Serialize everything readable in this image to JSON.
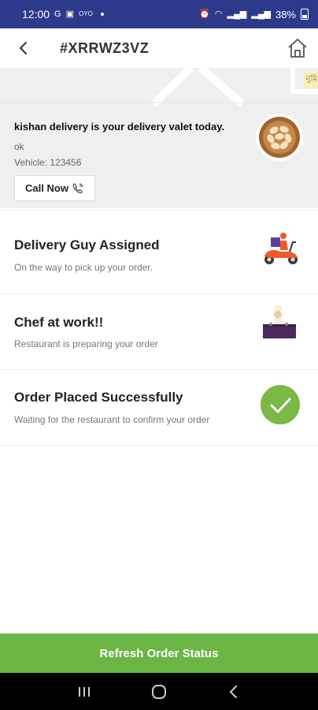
{
  "status_bar": {
    "time": "12:00",
    "battery": "38%"
  },
  "header": {
    "order_id": "#XRRWZ3VZ"
  },
  "delivery": {
    "map_label": "নুমি",
    "valet_title": "kishan delivery is your delivery valet today.",
    "note": "ok",
    "vehicle": "Vehicle: 123456",
    "call_label": "Call Now"
  },
  "statuses": [
    {
      "title": "Delivery Guy Assigned",
      "subtitle": "On the way to pick up your order.",
      "icon": "scooter-icon"
    },
    {
      "title": "Chef at work!!",
      "subtitle": "Restaurant is preparing your order",
      "icon": "chef-icon"
    },
    {
      "title": "Order Placed Successfully",
      "subtitle": "Waiting for the restaurant to confirm your order",
      "icon": "check-circle-icon"
    }
  ],
  "footer": {
    "refresh_label": "Refresh Order Status"
  },
  "colors": {
    "status_bar": "#2d3a8c",
    "accent_green": "#6bb544",
    "check_green": "#7cb844"
  }
}
